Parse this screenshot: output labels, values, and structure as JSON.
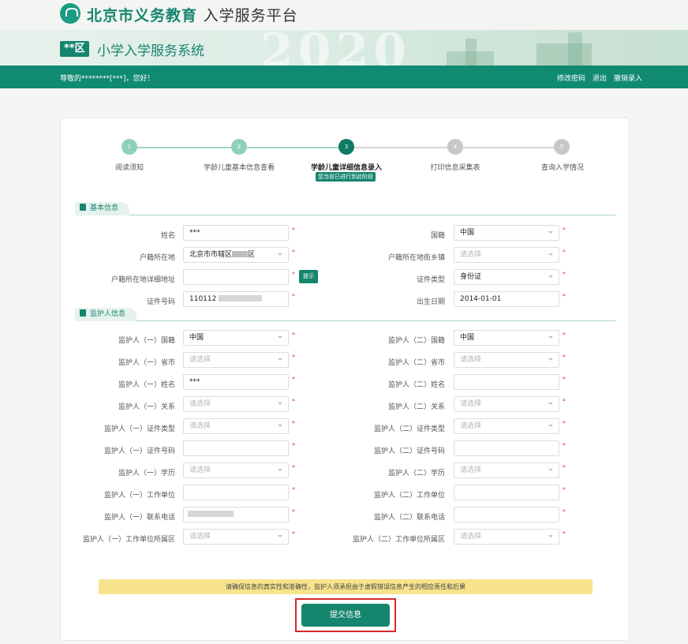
{
  "header": {
    "brand": "北京市义务教育",
    "brand_suffix": "入学服务平台",
    "district_badge": "**区",
    "system_name": "小学入学服务系统",
    "banner_deco": "2020"
  },
  "nav": {
    "greeting": "尊敬的********[***]，您好！",
    "links": [
      "修改密码",
      "退出",
      "撤销录入"
    ]
  },
  "steps": {
    "items": [
      {
        "num": "1",
        "label": "阅读须知",
        "state": "done"
      },
      {
        "num": "2",
        "label": "学龄儿童基本信息查看",
        "state": "done"
      },
      {
        "num": "3",
        "label": "学龄儿童详细信息录入",
        "state": "current"
      },
      {
        "num": "4",
        "label": "打印信息采集表",
        "state": "todo"
      },
      {
        "num": "5",
        "label": "查询入学情况",
        "state": "todo"
      }
    ],
    "current_note": "您当前已进行到此阶段"
  },
  "basic": {
    "title": "基本信息",
    "name_label": "姓名",
    "name_value": "***",
    "nationality_label": "国籍",
    "nationality_value": "中国",
    "hukou_label": "户籍所在地",
    "hukou_value": "北京市市辖区",
    "hukou_value_suffix": "区",
    "street_label": "户籍所在地街乡镇",
    "street_value": "请选择",
    "address_label": "户籍所在地详细地址",
    "address_value": "",
    "tip_button": "提示",
    "idtype_label": "证件类型",
    "idtype_value": "身份证",
    "idno_label": "证件号码",
    "idno_value": "110112",
    "birth_label": "出生日期",
    "birth_value": "2014-01-01"
  },
  "guardian": {
    "title": "监护人信息",
    "rows": [
      {
        "l1": "监护人（一）国籍",
        "v1": "中国",
        "l2": "监护人（二）国籍",
        "v2": "中国"
      },
      {
        "l1": "监护人（一）省市",
        "v1": "请选择",
        "l2": "监护人（二）省市",
        "v2": "请选择"
      },
      {
        "l1": "监护人（一）姓名",
        "v1": "***",
        "l2": "监护人（二）姓名",
        "v2": ""
      },
      {
        "l1": "监护人（一）关系",
        "v1": "请选择",
        "l2": "监护人（二）关系",
        "v2": "请选择"
      },
      {
        "l1": "监护人（一）证件类型",
        "v1": "请选择",
        "l2": "监护人（二）证件类型",
        "v2": "请选择"
      },
      {
        "l1": "监护人（一）证件号码",
        "v1": "",
        "l2": "监护人（二）证件号码",
        "v2": ""
      },
      {
        "l1": "监护人（一）学历",
        "v1": "请选择",
        "l2": "监护人（二）学历",
        "v2": "请选择"
      },
      {
        "l1": "监护人（一）工作单位",
        "v1": "",
        "l2": "监护人（二）工作单位",
        "v2": ""
      },
      {
        "l1": "监护人（一）联系电话",
        "v1": "",
        "l2": "监护人（二）联系电话",
        "v2": ""
      },
      {
        "l1": "监护人（一）工作单位所属区",
        "v1": "请选择",
        "l2": "监护人（二）工作单位所属区",
        "v2": "请选择"
      }
    ]
  },
  "required_mark": "*",
  "notice": "请确保信息的真实性和准确性，监护人须承担由于虚假错误信息产生的相应责任和后果",
  "submit_label": "提交信息",
  "colors": {
    "brand": "#16856e",
    "nav": "#118a72",
    "required": "#e53a3a",
    "highlight": "#d62a2a"
  }
}
